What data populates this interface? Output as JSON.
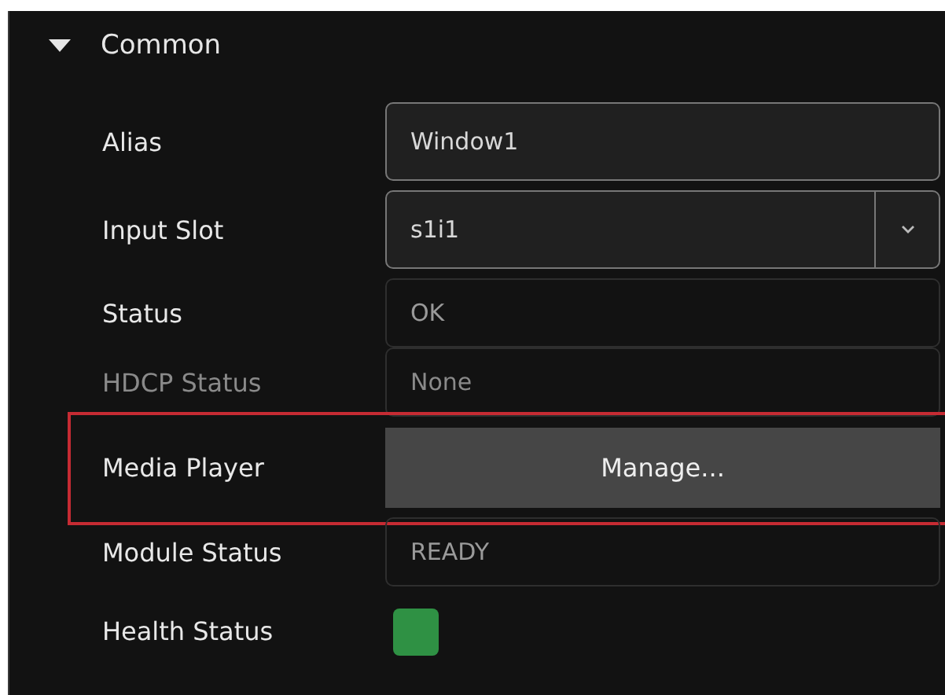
{
  "section": {
    "title": "Common",
    "expanded": true
  },
  "rows": [
    {
      "kind": "text",
      "label": "Alias",
      "value": "Window1"
    },
    {
      "kind": "dropdown",
      "label": "Input Slot",
      "value": "s1i1"
    },
    {
      "kind": "readonly",
      "label": "Status",
      "value": "OK",
      "dimmed": false
    },
    {
      "kind": "readonly",
      "label": "HDCP Status",
      "value": "None",
      "dimmed": true
    },
    {
      "kind": "button",
      "label": "Media Player",
      "value": "Manage...",
      "highlighted": true
    },
    {
      "kind": "readonly",
      "label": "Module Status",
      "value": "READY",
      "dimmed": false
    },
    {
      "kind": "swatch",
      "label": "Health Status",
      "color": "#2f9144"
    }
  ]
}
